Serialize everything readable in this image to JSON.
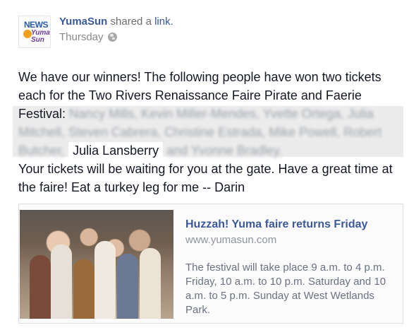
{
  "header": {
    "author": "YumaSun",
    "action_prefix": "shared a",
    "action_link": "link.",
    "timestamp": "Thursday",
    "privacy_icon": "globe-icon"
  },
  "avatar": {
    "logo_text_top": "NEWS",
    "logo_text_bottom": "Yuma Sun"
  },
  "message": {
    "line_intro": "We have our winners! The following people have won two tickets each for the Two Rivers Renaissance Faire Pirate and Faerie Festival:",
    "blurred_names_1": "Nancy Mills, Kevin Miller-Mendes, Yvette Ortega, Julia Mitchell, Steven Cabrera, Christine Estrada, Mike Powell, Robert Butcher,",
    "winner_visible": "Julia Lansberry",
    "blurred_names_2": "and Yvonne Bradley.",
    "closing": "Your tickets will be waiting for you at the gate. Have a great time at the faire! Eat a turkey leg for me -- Darin"
  },
  "link_card": {
    "title": "Huzzah! Yuma faire returns Friday",
    "domain": "www.yumasun.com",
    "description": "The festival will take place 9 a.m. to 4 p.m. Friday, 10 a.m. to 10 p.m. Saturday and 10 a.m. to 5 p.m. Sunday at West Wetlands Park."
  }
}
